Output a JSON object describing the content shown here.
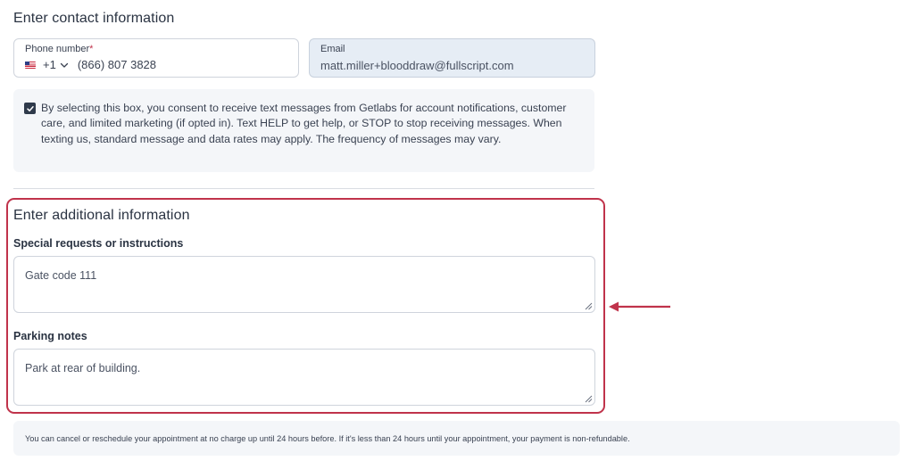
{
  "contact": {
    "title": "Enter contact information",
    "phone": {
      "label": "Phone number",
      "required_mark": "*",
      "country_code": "+1",
      "value": "(866) 807 3828",
      "flag_icon": "us-flag-icon"
    },
    "email": {
      "label": "Email",
      "value": "matt.miller+blooddraw@fullscript.com"
    },
    "consent": {
      "checked": true,
      "text": "By selecting this box, you consent to receive text messages from Getlabs for account notifications, customer care, and limited marketing (if opted in). Text HELP to get help, or STOP to stop receiving messages. When texting us, standard message and data rates may apply. The frequency of messages may vary."
    }
  },
  "additional": {
    "title": "Enter additional information",
    "special_requests": {
      "label": "Special requests or instructions",
      "value": "Gate code 111"
    },
    "parking": {
      "label": "Parking notes",
      "value": "Park at rear of building."
    }
  },
  "notice": {
    "text": "You can cancel or reschedule your appointment at no charge up until 24 hours before. If it's less than 24 hours until your appointment, your payment is non-refundable."
  },
  "colors": {
    "highlight": "#c0334b",
    "checkbox": "#2f3a4b",
    "email_bg": "#e6edf5",
    "panel_bg": "#f4f6f9"
  }
}
